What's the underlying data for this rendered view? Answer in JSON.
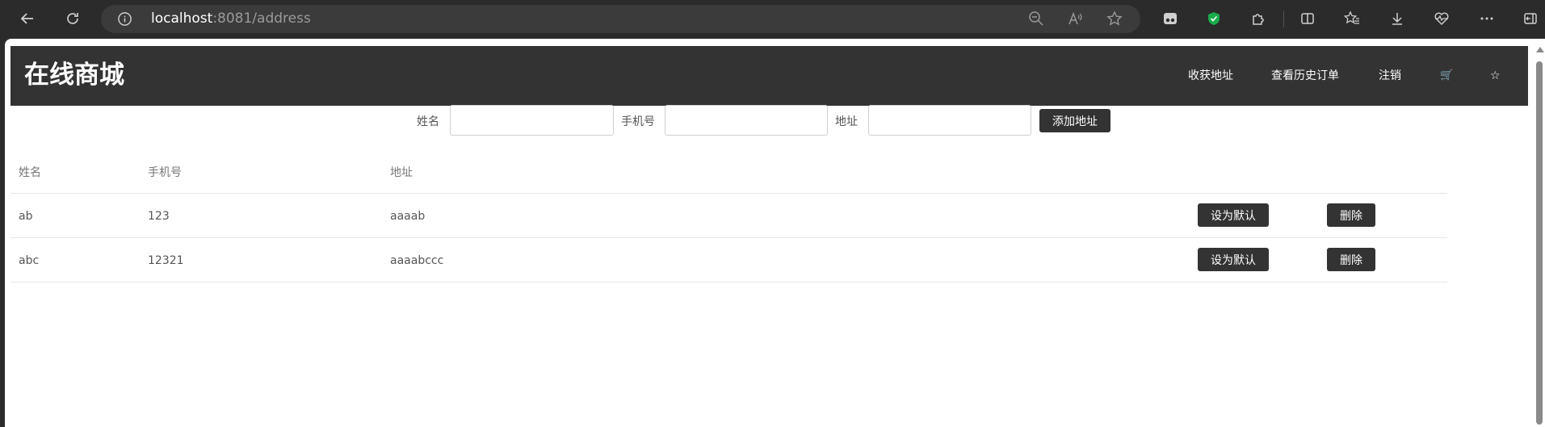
{
  "browser": {
    "url_host": "localhost",
    "url_rest": ":8081/address"
  },
  "header": {
    "brand": "在线商城",
    "nav": [
      "收获地址",
      "查看历史订单",
      "注销",
      "🛒",
      "☆"
    ]
  },
  "form": {
    "name_label": "姓名",
    "phone_label": "手机号",
    "address_label": "地址",
    "name_value": "",
    "phone_value": "",
    "address_value": "",
    "add_button": "添加地址"
  },
  "table": {
    "headers": [
      "姓名",
      "手机号",
      "地址"
    ],
    "rows": [
      {
        "name": "ab",
        "phone": "123",
        "address": "aaaab",
        "set_default": "设为默认",
        "delete": "删除"
      },
      {
        "name": "abc",
        "phone": "12321",
        "address": "aaaabccc",
        "set_default": "设为默认",
        "delete": "删除"
      }
    ]
  },
  "icons": {
    "back": "back-arrow-icon",
    "refresh": "refresh-icon",
    "info": "info-icon",
    "zoom": "zoom-out-icon",
    "read_aloud": "read-aloud-icon",
    "favorite": "star-icon",
    "extensions": "puzzle-icon",
    "split": "split-screen-icon",
    "favorites_list": "favorites-icon",
    "download": "download-icon",
    "health": "heart-pulse-icon",
    "more": "more-icon",
    "sidebar": "sidebar-exit-icon"
  },
  "colors": {
    "header_bg": "#333333",
    "button_bg": "#333333",
    "shield": "#1aab4b"
  }
}
